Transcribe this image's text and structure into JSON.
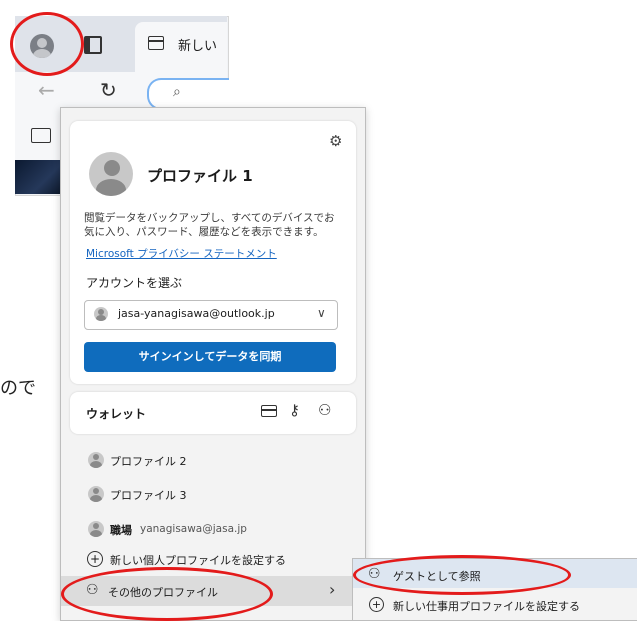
{
  "browser": {
    "tab_label": "新しい",
    "favorites_icon": "folder-sync-icon"
  },
  "panel": {
    "settings_icon": "gear-icon",
    "profile_name": "プロファイル 1",
    "description": "閲覧データをバックアップし、すべてのデバイスでお気に入り、パスワード、履歴などを表示できます。",
    "privacy_link": "Microsoft プライバシー ステートメント",
    "choose_account_label": "アカウントを選ぶ",
    "account_email": "jasa-yanagisawa@outlook.jp",
    "signin_button": "サインインしてデータを同期",
    "wallet_label": "ウォレット",
    "profiles": [
      {
        "name": "プロファイル 2"
      },
      {
        "name": "プロファイル 3"
      },
      {
        "name": "職場",
        "email": "yanagisawa@jasa.jp"
      }
    ],
    "add_personal_profile": "新しい個人プロファイルを設定する",
    "other_profiles": "その他のプロファイル",
    "other_profiles_chevron": "›"
  },
  "submenu": {
    "guest": "ゲストとして参照",
    "add_work_profile": "新しい仕事用プロファイルを設定する"
  },
  "side_text": "ので",
  "colors": {
    "accent": "#0f6cbd",
    "highlight_ring": "#e31b1b"
  }
}
